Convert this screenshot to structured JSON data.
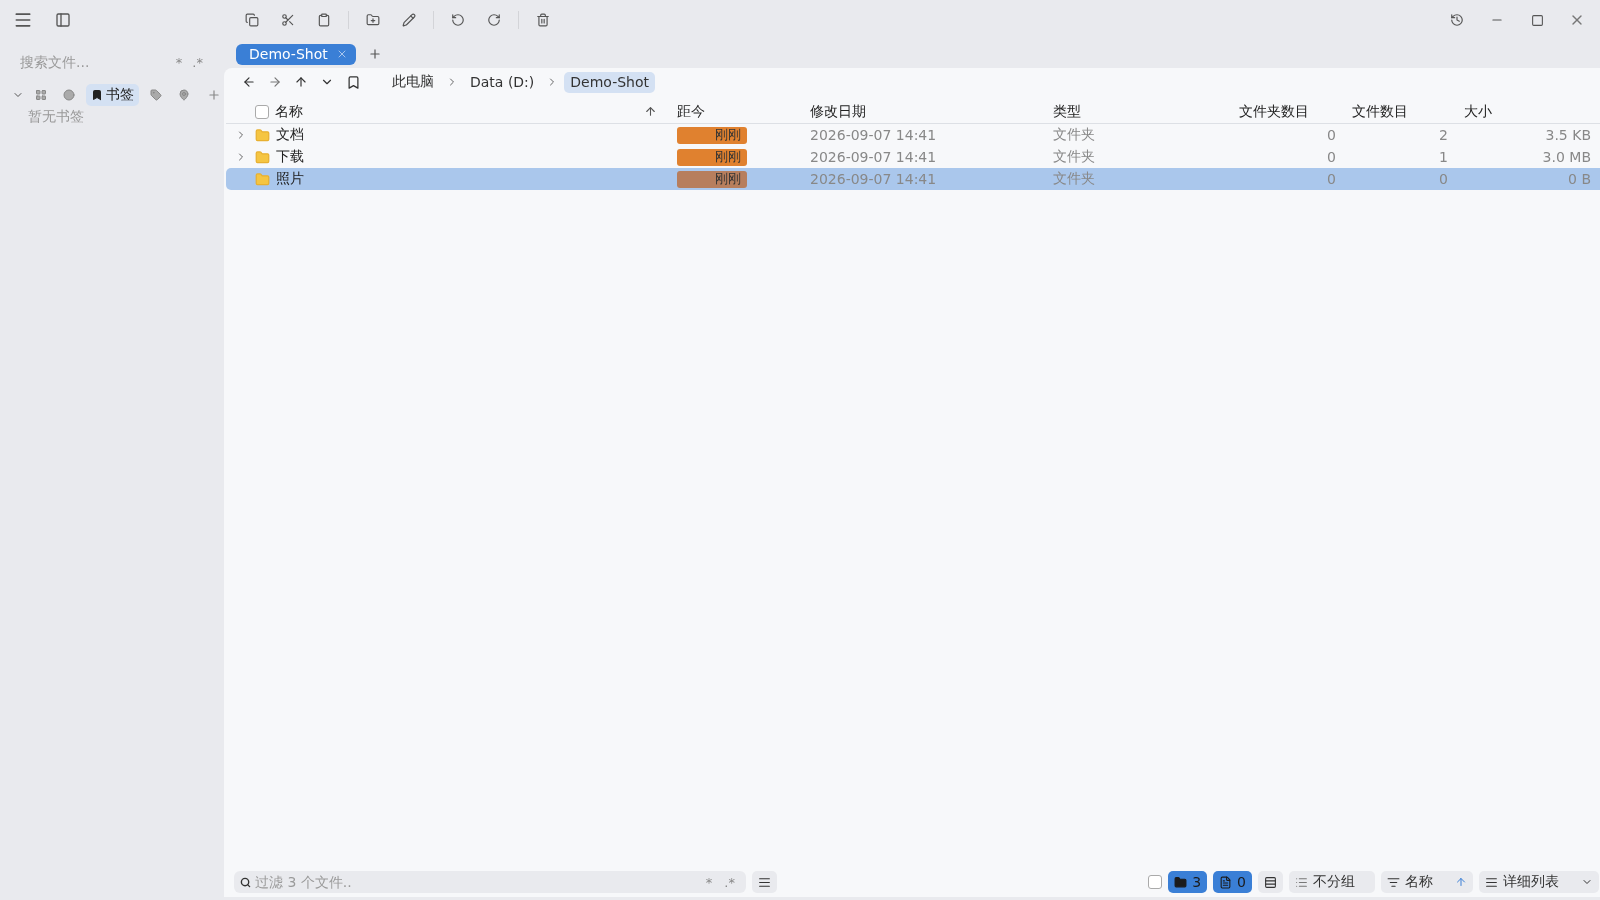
{
  "sidebar": {
    "search": {
      "placeholder": "搜索文件...",
      "toggles": [
        "*",
        ".*"
      ]
    },
    "panel_tabs": [
      {
        "kind": "layout",
        "selected": false
      },
      {
        "kind": "recent",
        "selected": false
      },
      {
        "kind": "bookmarks",
        "label": "书签",
        "selected": true
      },
      {
        "kind": "tags",
        "selected": false
      },
      {
        "kind": "pins",
        "selected": false
      }
    ],
    "empty_text": "暂无书签"
  },
  "tabs": [
    {
      "label": "Demo-Shot",
      "selected": true
    }
  ],
  "breadcrumbs": [
    {
      "label": "此电脑",
      "selected": false
    },
    {
      "label": "Data (D:)",
      "selected": false
    },
    {
      "label": "Demo-Shot",
      "selected": true
    }
  ],
  "table": {
    "select_all_checked": false,
    "columns": [
      "名称",
      "距今",
      "修改日期",
      "类型",
      "文件夹数目",
      "文件数目",
      "大小"
    ],
    "rows": [
      {
        "name": "文档",
        "expandable": true,
        "age": "刚刚",
        "modified": "2026-09-07 14:41",
        "type": "文件夹",
        "folders": "0",
        "files": "2",
        "size": "3.5 KB",
        "selected": false
      },
      {
        "name": "下载",
        "expandable": true,
        "age": "刚刚",
        "modified": "2026-09-07 14:41",
        "type": "文件夹",
        "folders": "0",
        "files": "1",
        "size": "3.0 MB",
        "selected": false
      },
      {
        "name": "照片",
        "expandable": false,
        "age": "刚刚",
        "modified": "2026-09-07 14:41",
        "type": "文件夹",
        "folders": "0",
        "files": "0",
        "size": "0 B",
        "selected": true
      }
    ]
  },
  "status_bar": {
    "filter": {
      "placeholder": "过滤 3 个文件..",
      "toggles": [
        "*",
        ".*"
      ]
    },
    "select_checked": false,
    "folder_count": "3",
    "file_count": "0",
    "grouping": "不分组",
    "sort": "名称",
    "view": "详细列表"
  }
}
